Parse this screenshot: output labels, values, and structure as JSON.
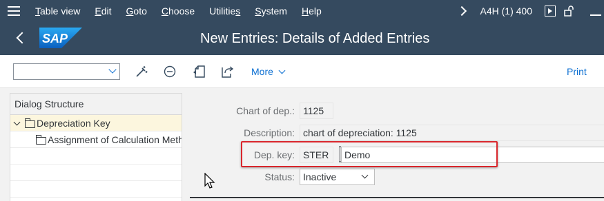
{
  "menubar": {
    "items": [
      "Table view",
      "Edit",
      "Goto",
      "Choose",
      "Utilities",
      "System",
      "Help"
    ],
    "underlined": [
      "T",
      "E",
      "G",
      "C",
      "",
      "S",
      "H"
    ],
    "system_info": "A4H (1) 400"
  },
  "titlebar": {
    "logo_text": "SAP",
    "title": "New Entries: Details of Added Entries"
  },
  "toolbar": {
    "more_label": "More",
    "print_label": "Print"
  },
  "dialog_structure": {
    "header": "Dialog Structure",
    "items": [
      {
        "label": "Depreciation Key"
      },
      {
        "label": "Assignment of Calculation Methods"
      }
    ]
  },
  "form": {
    "chart_of_dep_label": "Chart of dep.:",
    "chart_of_dep_value": "1125",
    "description_label": "Description:",
    "description_value": "chart of depreciation: 1125",
    "dep_key_label": "Dep. key:",
    "dep_key_value": "STER",
    "dep_key_description": "Demo",
    "status_label": "Status:",
    "status_value": "Inactive"
  },
  "colors": {
    "shell": "#354a5f",
    "accent": "#0a6ed1",
    "highlight": "#d9262c",
    "selected_row": "#fcf6de"
  },
  "icons": [
    "menu-icon",
    "chevron-right-icon",
    "box-icon",
    "unlock-icon",
    "minimize-icon",
    "back-icon",
    "sap-logo",
    "magic-wand-icon",
    "minus-circle-icon",
    "copy-icon",
    "export-icon",
    "folder-icon",
    "mouse-pointer-icon"
  ]
}
